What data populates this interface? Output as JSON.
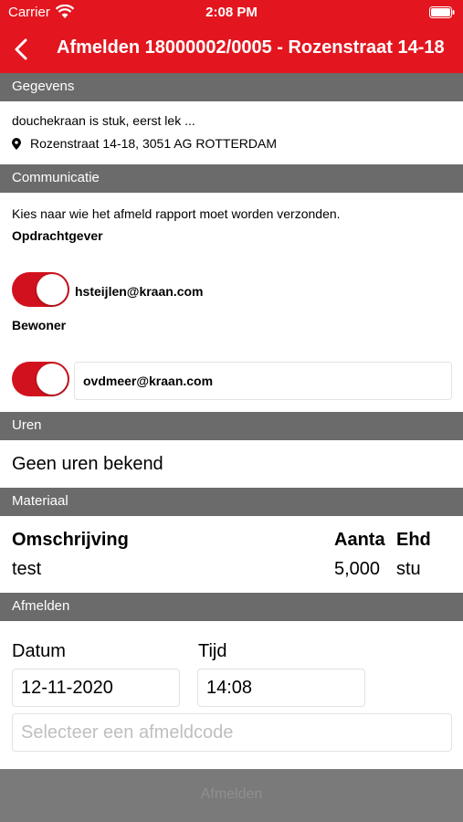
{
  "status_bar": {
    "carrier": "Carrier",
    "time": "2:08 PM"
  },
  "nav": {
    "title": "Afmelden 18000002/0005 - Rozenstraat 14-18"
  },
  "sections": {
    "gegevens": "Gegevens",
    "communicatie": "Communicatie",
    "uren": "Uren",
    "materiaal": "Materiaal",
    "afmelden": "Afmelden"
  },
  "gegevens": {
    "description": "douchekraan is stuk, eerst lek  ...",
    "address": "Rozenstraat 14-18, 3051 AG ROTTERDAM"
  },
  "communicatie": {
    "instruction": "Kies naar wie het afmeld rapport moet worden verzonden.",
    "opdrachtgever_label": "Opdrachtgever",
    "opdrachtgever_email": "hsteijlen@kraan.com",
    "opdrachtgever_enabled": true,
    "bewoner_label": "Bewoner",
    "bewoner_email": "ovdmeer@kraan.com",
    "bewoner_enabled": true
  },
  "uren": {
    "text": "Geen uren bekend"
  },
  "materiaal": {
    "headers": {
      "omschrijving": "Omschrijving",
      "aantal": "Aanta",
      "eenheid": "Ehd"
    },
    "rows": [
      {
        "omschrijving": "test",
        "aantal": "5,000",
        "eenheid": "stu"
      }
    ]
  },
  "afmelden": {
    "datum_label": "Datum",
    "datum_value": "12-11-2020",
    "tijd_label": "Tijd",
    "tijd_value": "14:08",
    "code_placeholder": "Selecteer een afmeldcode",
    "submit_label": "Afmelden"
  },
  "colors": {
    "brand_red": "#e3161f",
    "toggle_on": "#d1121e",
    "section_gray": "#6b6b6b",
    "disabled_button": "#7a7a7a"
  },
  "icons": [
    "wifi-icon",
    "battery-icon",
    "back-chevron-icon",
    "location-pin-icon"
  ]
}
